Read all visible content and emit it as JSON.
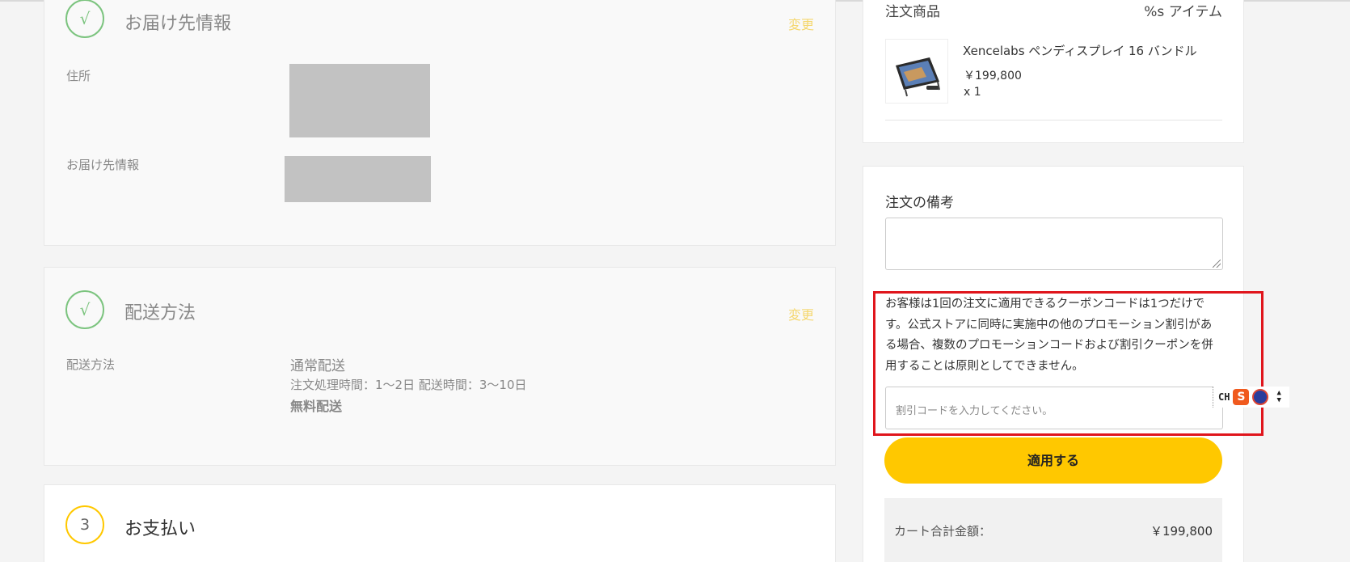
{
  "shipping_info": {
    "step_mark": "√",
    "title": "お届け先情報",
    "change_label": "変更",
    "address_label": "住所",
    "recipient_label": "お届け先情報"
  },
  "delivery": {
    "step_mark": "√",
    "title": "配送方法",
    "change_label": "変更",
    "method_label": "配送方法",
    "method_name": "通常配送",
    "processing_time": "注文処理時間：1〜2日 配送時間：3〜10日",
    "fee_text": "無料配送"
  },
  "payment": {
    "step_number": "3",
    "title": "お支払い"
  },
  "order_items": {
    "header_label": "注文商品",
    "count_label": "%s アイテム",
    "product": {
      "name": "Xencelabs ペンディスプレイ 16 バンドル",
      "price": "￥199,800",
      "quantity": "x 1"
    }
  },
  "notes": {
    "label": "注文の備考",
    "value": ""
  },
  "coupon": {
    "notice": "お客様は1回の注文に適用できるクーポンコードは1つだけです。公式ストアに同時に実施中の他のプロモーション割引がある場合、複数のプロモーションコードおよび割引クーポンを併用することは原則としてできません。",
    "placeholder": "割引コードを入力してください。",
    "value": "",
    "apply_label": "適用する"
  },
  "extension_toolbar": {
    "lang_label": "CH",
    "s_label": "S"
  },
  "summary": {
    "cart_total_label": "カート合計金額：",
    "cart_total_value": "￥199,800"
  }
}
